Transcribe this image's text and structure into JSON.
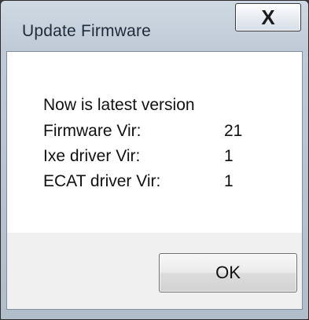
{
  "window": {
    "title": "Update Firmware",
    "close_glyph": "X"
  },
  "message": {
    "status": "Now is latest version",
    "rows": [
      {
        "label": "Firmware Vir:",
        "value": "21"
      },
      {
        "label": "Ixe driver Vir:",
        "value": "1"
      },
      {
        "label": "ECAT driver Vir:",
        "value": "1"
      }
    ]
  },
  "actions": {
    "ok_label": "OK"
  },
  "colors": {
    "dialog_frame": "#bfcad6",
    "content_background": "#ffffff",
    "button_strip": "#f0f0f0"
  }
}
